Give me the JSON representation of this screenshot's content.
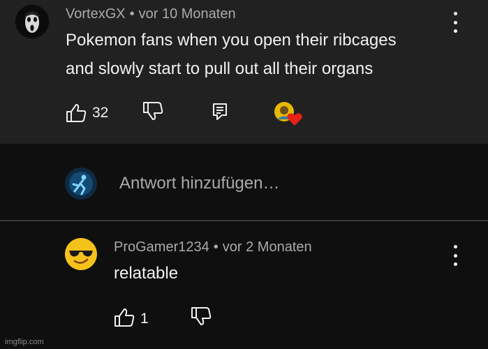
{
  "comment": {
    "author": "VortexGX",
    "time": "vor 10 Monaten",
    "text_line1": "Pokemon fans when you open their ribcages",
    "text_line2": "and slowly start to pull out all their organs",
    "likes": "32",
    "icons": [
      "like-icon",
      "dislike-icon",
      "reply-icon",
      "creator-heart-icon",
      "more-vert-icon"
    ]
  },
  "reply_box": {
    "placeholder": "Antwort hinzufügen…"
  },
  "reply": {
    "author": "ProGamer1234",
    "time": "vor 2 Monaten",
    "text": "relatable",
    "likes": "1",
    "icons": [
      "like-icon",
      "dislike-icon",
      "more-vert-icon"
    ]
  },
  "separator": "•",
  "watermark": "imgflip.com",
  "colors": {
    "panel": "#212121",
    "background": "#0f0f0f",
    "meta_text": "#aaaaaa",
    "heart": "#e62117"
  }
}
